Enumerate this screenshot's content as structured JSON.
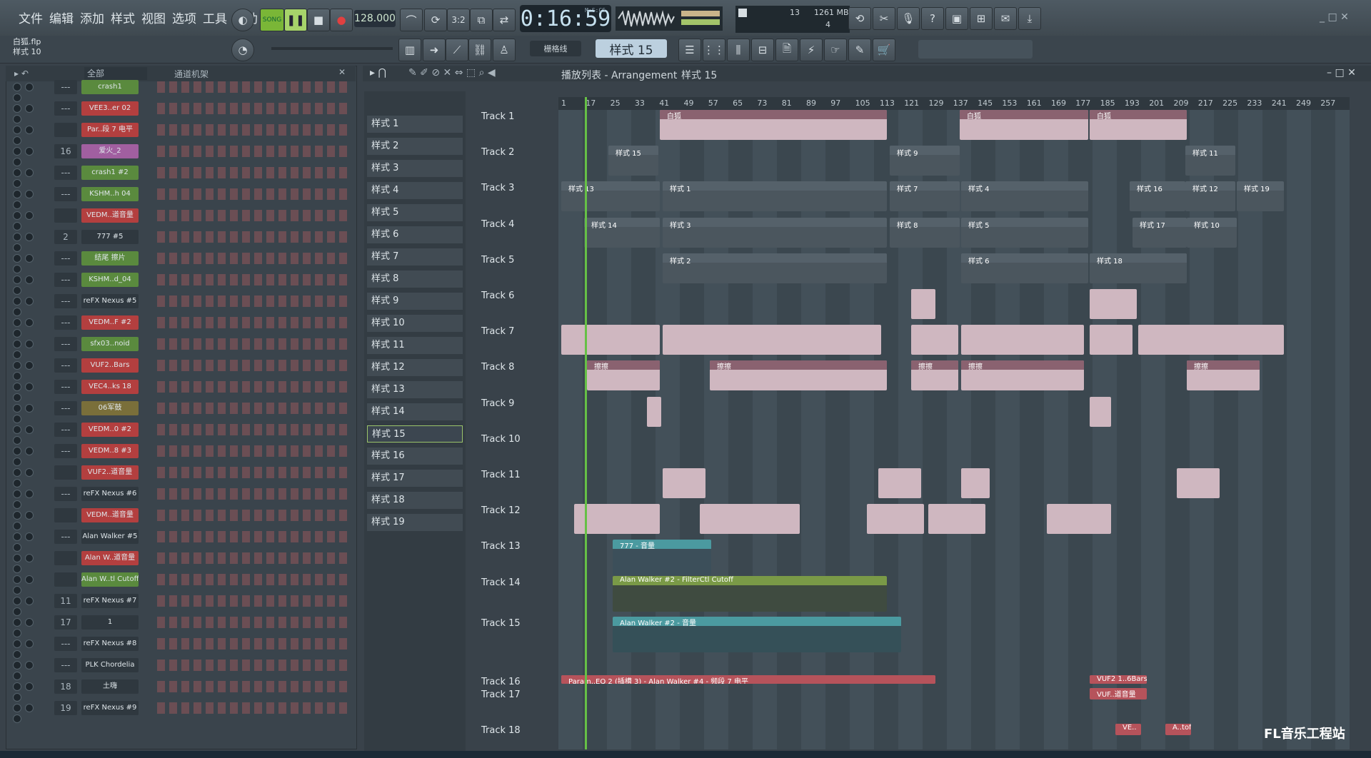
{
  "menu": [
    "文件",
    "编辑",
    "添加",
    "样式",
    "视图",
    "选项",
    "工具",
    "帮助"
  ],
  "transport": {
    "song_label": "SONG",
    "tempo": "128.000",
    "time": "0:16:59",
    "time_unit": "M:S:CS"
  },
  "cpu": {
    "value1": "13",
    "memory": "1261 MB",
    "value2": "4"
  },
  "project": {
    "file": "白狐.flp",
    "pattern": "样式 10"
  },
  "toolbar2": {
    "snap": "栅格线",
    "pattern_selector": "样式 15"
  },
  "rack": {
    "filter": "全部",
    "title": "通道机架"
  },
  "channels": [
    {
      "num": "---",
      "name": "crash1",
      "color": "#5a8a3e"
    },
    {
      "num": "---",
      "name": "VEE3..er 02",
      "color": "#b33f3f"
    },
    {
      "num": "",
      "name": "Par..段 7 电平",
      "color": "#b33f3f"
    },
    {
      "num": "16",
      "name": "爱火_2",
      "color": "#a15fa0"
    },
    {
      "num": "---",
      "name": "crash1 #2",
      "color": "#5a8a3e"
    },
    {
      "num": "---",
      "name": "KSHM..h 04",
      "color": "#5a8a3e"
    },
    {
      "num": "",
      "name": "VEDM..道音量",
      "color": "#b33f3f"
    },
    {
      "num": "2",
      "name": "777 #5",
      "color": "#2f383f"
    },
    {
      "num": "---",
      "name": "结尾 擦片",
      "color": "#5a8a3e"
    },
    {
      "num": "---",
      "name": "KSHM..d_04",
      "color": "#5a8a3e"
    },
    {
      "num": "---",
      "name": "reFX Nexus #5",
      "color": "#2f383f"
    },
    {
      "num": "---",
      "name": "VEDM..F #2",
      "color": "#b33f3f"
    },
    {
      "num": "---",
      "name": "sfx03..noid",
      "color": "#5a8a3e"
    },
    {
      "num": "---",
      "name": "VUF2..Bars",
      "color": "#b33f3f"
    },
    {
      "num": "---",
      "name": "VEC4..ks 18",
      "color": "#b33f3f"
    },
    {
      "num": "---",
      "name": "06军鼓",
      "color": "#7a6f3a"
    },
    {
      "num": "---",
      "name": "VEDM..0 #2",
      "color": "#b33f3f"
    },
    {
      "num": "---",
      "name": "VEDM..8 #3",
      "color": "#b33f3f"
    },
    {
      "num": "",
      "name": "VUF2..道音量",
      "color": "#b33f3f"
    },
    {
      "num": "---",
      "name": "reFX Nexus #6",
      "color": "#2f383f"
    },
    {
      "num": "",
      "name": "VEDM..道音量",
      "color": "#b33f3f"
    },
    {
      "num": "---",
      "name": "Alan Walker #5",
      "color": "#2f383f"
    },
    {
      "num": "",
      "name": "Alan W..道音量",
      "color": "#b33f3f"
    },
    {
      "num": "",
      "name": "Alan W..tl Cutoff",
      "color": "#5a8a3e"
    },
    {
      "num": "11",
      "name": "reFX Nexus #7",
      "color": "#2f383f"
    },
    {
      "num": "17",
      "name": "1",
      "color": "#2f383f"
    },
    {
      "num": "---",
      "name": "reFX Nexus #8",
      "color": "#2f383f"
    },
    {
      "num": "---",
      "name": "PLK Chordelia",
      "color": "#2f383f"
    },
    {
      "num": "18",
      "name": "土嗨",
      "color": "#2f383f"
    },
    {
      "num": "19",
      "name": "reFX Nexus #9",
      "color": "#2f383f"
    }
  ],
  "patterns": [
    "样式 1",
    "样式 2",
    "样式 3",
    "样式 4",
    "样式 5",
    "样式 6",
    "样式 7",
    "样式 8",
    "样式 9",
    "样式 10",
    "样式 11",
    "样式 12",
    "样式 13",
    "样式 14",
    "样式 15",
    "样式 16",
    "样式 17",
    "样式 18",
    "样式 19"
  ],
  "playlist": {
    "title": "播放列表 - Arrangement",
    "pattern": "样式 15"
  },
  "ruler": [
    "1",
    "17",
    "25",
    "33",
    "41",
    "49",
    "57",
    "65",
    "73",
    "81",
    "89",
    "97",
    "105",
    "113",
    "121",
    "129",
    "137",
    "145",
    "153",
    "161",
    "169",
    "177",
    "185",
    "193",
    "201",
    "209",
    "217",
    "225",
    "233",
    "241",
    "249",
    "257"
  ],
  "tracks": [
    "Track 1",
    "Track 2",
    "Track 3",
    "Track 4",
    "Track 5",
    "Track 6",
    "Track 7",
    "Track 8",
    "Track 9",
    "Track 10",
    "Track 11",
    "Track 12",
    "Track 13",
    "Track 14",
    "Track 15",
    "Track 16",
    "Track 17",
    "Track 18"
  ],
  "clips": {
    "t1a": "白狐",
    "t1b": "白狐",
    "t1c": "白狐",
    "t2a": "样式 15",
    "t2b": "样式 9",
    "t2c": "样式 11",
    "t3a": "样式 13",
    "t3b": "样式 1",
    "t3c": "样式 7",
    "t3d": "样式 4",
    "t3e": "样式 16",
    "t3f": "样式 12",
    "t3g": "样式 19",
    "t4a": "样式 14",
    "t4b": "样式 3",
    "t4c": "样式 8",
    "t4d": "样式 5",
    "t4e": "样式 17",
    "t4f": "样式 10",
    "t5a": "样式 2",
    "t5b": "样式 6",
    "t5c": "样式 18",
    "t8": "擦擦",
    "t13": "777 - 音量",
    "t14": "Alan Walker #2 - FilterCtl Cutoff",
    "t15": "Alan Walker #2 - 音量",
    "t16": "Param..EQ 2 (插槽 3) - Alan Walker #4 - 频段 7 电平",
    "t16b": "VUF2 1..6Bars",
    "t17": "VUF..道音量",
    "t18a": "VE..",
    "t18b": "A..toff"
  },
  "watermark": "FL音乐工程站"
}
